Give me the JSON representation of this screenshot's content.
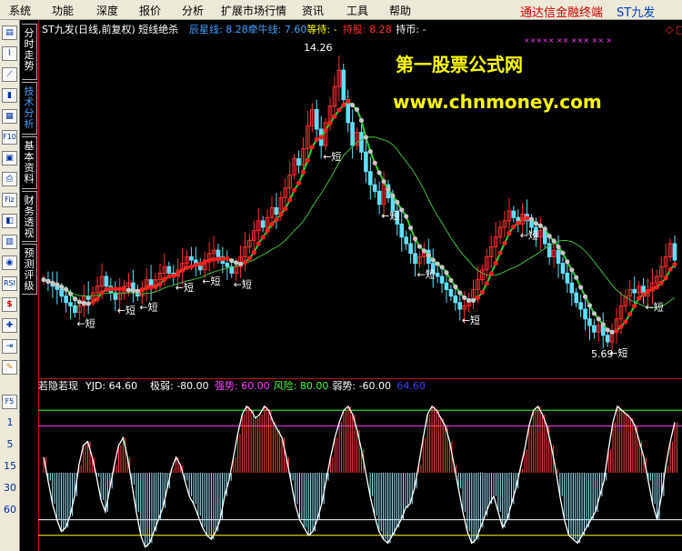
{
  "menu": [
    "系统",
    "功能",
    "深度",
    "报价",
    "分析",
    "扩展市场行情",
    "资讯",
    "工具",
    "帮助"
  ],
  "brand": "通达信金融终端",
  "ticker_name": "ST九发",
  "left_tabs": [
    "分时走势",
    "技术分析",
    "基本资料",
    "财务透视",
    "预测评级"
  ],
  "left_toolbar_icons": [
    "report-icon",
    "tick-icon",
    "line-chart-icon",
    "kline-icon",
    "grid-icon",
    "f10-icon",
    "news-icon",
    "print-icon",
    "fiz-icon",
    "fund-icon",
    "table-icon",
    "monitor-icon",
    "rsi-icon",
    "money-icon",
    "cross-icon",
    "export-icon",
    "pen-icon"
  ],
  "icon_labels": {
    "f10": "F10",
    "fiz": "Fiz",
    "rsi": "RSI",
    "f5": "F5"
  },
  "period_buttons": [
    "1",
    "5",
    "15",
    "30",
    "60"
  ],
  "main_header": {
    "title": "ST九发(日线,前复权) 短线绝杀",
    "items": [
      {
        "label": "辰星线: 8.28",
        "color": "#40a0ff"
      },
      {
        "label": "牵牛线: 7.60",
        "color": "#40a0ff"
      },
      {
        "label": "等待: -",
        "color": "#ffff00"
      },
      {
        "label": "持股: 8.28",
        "color": "#ff3030"
      },
      {
        "label": "持币: -",
        "color": "#ffffff"
      }
    ]
  },
  "watermark": {
    "line1": "第一股票公式网",
    "line2": "www.chnmoney.com",
    "color": "#ffff00"
  },
  "annotations": {
    "high": "14.26",
    "low": "5.69",
    "short_label": "短"
  },
  "sub_header": {
    "title": "若隐若现",
    "items": [
      {
        "label": "YJD: 64.60",
        "color": "#ffffff"
      },
      {
        "label": "极弱: -80.00",
        "color": "#ffffff"
      },
      {
        "label": "强势: 60.00",
        "color": "#ff40ff"
      },
      {
        "label": "风险: 80.00",
        "color": "#40ff40"
      },
      {
        "label": "弱势: -60.00",
        "color": "#ffffff"
      },
      {
        "label": "64.60",
        "color": "#4040ff"
      }
    ]
  },
  "chart_data": [
    {
      "type": "candlestick",
      "title": "ST九发(日线,前复权) 短线绝杀",
      "price_labels": {
        "high": 14.26,
        "low": 5.69
      },
      "y_range": [
        5.3,
        14.8
      ],
      "series": [
        {
          "name": "辰星线",
          "last_value": 8.28
        },
        {
          "name": "牵牛线",
          "last_value": 7.6
        }
      ],
      "closes": [
        7.7,
        7.6,
        7.5,
        7.4,
        7.2,
        7.0,
        6.9,
        6.7,
        6.9,
        7.2,
        7.1,
        7.3,
        7.5,
        7.8,
        7.5,
        7.3,
        7.1,
        7.3,
        7.5,
        7.6,
        7.4,
        7.2,
        7.4,
        7.7,
        7.5,
        7.7,
        7.9,
        8.1,
        7.9,
        7.8,
        8.0,
        8.2,
        8.4,
        8.3,
        8.2,
        8.0,
        8.3,
        8.5,
        8.6,
        8.4,
        8.2,
        8.1,
        7.9,
        8.1,
        8.4,
        8.7,
        8.9,
        9.2,
        9.5,
        9.3,
        9.6,
        9.9,
        9.7,
        10.2,
        10.5,
        10.9,
        11.4,
        11.2,
        11.7,
        12.4,
        12.9,
        12.3,
        11.8,
        12.5,
        13.0,
        13.6,
        14.1,
        13.2,
        12.5,
        11.8,
        12.2,
        11.6,
        11.0,
        10.6,
        10.4,
        10.0,
        10.6,
        10.2,
        9.8,
        9.4,
        9.0,
        8.8,
        8.5,
        8.2,
        8.4,
        8.6,
        8.2,
        7.9,
        7.8,
        7.6,
        7.4,
        7.2,
        7.0,
        6.8,
        6.9,
        7.1,
        7.4,
        7.7,
        8.0,
        8.4,
        8.7,
        9.0,
        9.3,
        9.5,
        9.8,
        9.6,
        9.4,
        9.7,
        9.5,
        9.3,
        9.0,
        9.2,
        8.8,
        8.4,
        8.6,
        8.2,
        7.9,
        7.6,
        7.3,
        7.0,
        6.8,
        6.5,
        6.3,
        6.1,
        6.3,
        6.0,
        5.8,
        6.1,
        6.5,
        6.9,
        7.2,
        7.4,
        7.3,
        7.5,
        7.2,
        7.4,
        7.6,
        7.8,
        8.1,
        8.4,
        8.8,
        8.3
      ]
    },
    {
      "type": "line",
      "title": "若隐若现",
      "y_range": [
        -100,
        100
      ],
      "reference_lines": [
        {
          "name": "风险",
          "value": 80,
          "color": "#40ff40"
        },
        {
          "name": "强势",
          "value": 60,
          "color": "#ff40ff"
        },
        {
          "name": "弱势",
          "value": -60,
          "color": "#ffffff"
        },
        {
          "name": "极弱",
          "value": -80,
          "color": "#ffff00"
        }
      ],
      "series": [
        {
          "name": "YJD",
          "last_value": 64.6,
          "values": [
            20,
            -10,
            -40,
            -60,
            -75,
            -70,
            -55,
            -30,
            10,
            35,
            40,
            20,
            -5,
            -35,
            -50,
            -20,
            10,
            35,
            45,
            20,
            -15,
            -50,
            -80,
            -95,
            -90,
            -75,
            -60,
            -45,
            -20,
            5,
            20,
            10,
            -10,
            -30,
            -40,
            -55,
            -70,
            -80,
            -85,
            -75,
            -60,
            -30,
            -10,
            20,
            50,
            75,
            85,
            80,
            70,
            75,
            85,
            80,
            65,
            55,
            45,
            20,
            -10,
            -40,
            -60,
            -70,
            -80,
            -75,
            -60,
            -40,
            -10,
            20,
            45,
            65,
            80,
            85,
            75,
            55,
            30,
            0,
            -30,
            -55,
            -75,
            -85,
            -90,
            -80,
            -70,
            -60,
            -45,
            -40,
            -20,
            10,
            45,
            75,
            85,
            80,
            70,
            60,
            40,
            10,
            -20,
            -50,
            -75,
            -90,
            -85,
            -70,
            -55,
            -40,
            -30,
            -50,
            -70,
            -60,
            -40,
            -20,
            5,
            30,
            60,
            80,
            85,
            75,
            60,
            35,
            5,
            -30,
            -60,
            -80,
            -85,
            -90,
            -80,
            -70,
            -60,
            -50,
            -30,
            -10,
            30,
            65,
            85,
            80,
            75,
            70,
            60,
            40,
            20,
            -10,
            -40,
            -60,
            -30,
            10,
            40,
            64.6
          ]
        }
      ]
    }
  ]
}
